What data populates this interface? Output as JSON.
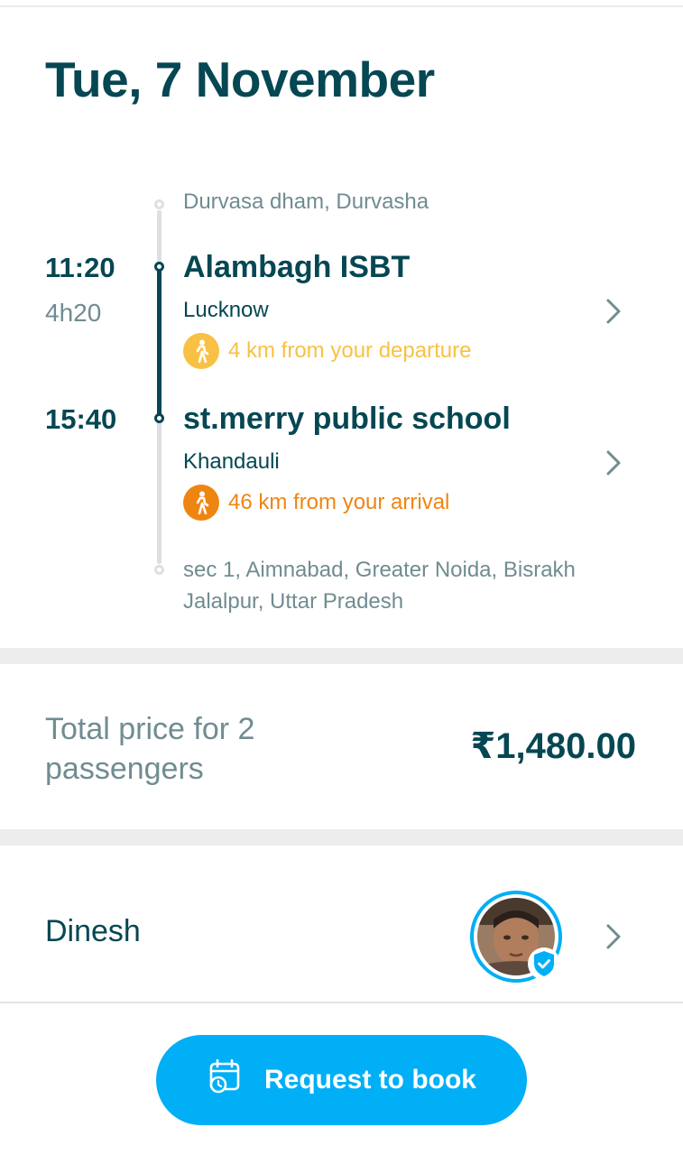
{
  "trip": {
    "date": "Tue, 7 November",
    "origin_area": "Durvasa dham, Durvasha",
    "departure": {
      "time": "11:20",
      "duration": "4h20",
      "stop": "Alambagh ISBT",
      "city": "Lucknow",
      "walk_note": "4 km from your departure",
      "walk_color": "#f8c144"
    },
    "arrival": {
      "time": "15:40",
      "stop": "st.merry public school",
      "city": "Khandauli",
      "walk_note": "46 km from your arrival",
      "walk_color": "#ef8511"
    },
    "destination_area_line1": "sec 1, Aimnabad, Greater Noida, Bisrakh",
    "destination_area_line2": "Jalalpur, Uttar Pradesh"
  },
  "price": {
    "label": "Total price for 2 passengers",
    "amount": "₹1,480.00"
  },
  "driver": {
    "name": "Dinesh",
    "verified": true
  },
  "cta": {
    "label": "Request to book",
    "icon": "calendar-clock-icon"
  },
  "colors": {
    "primary_text": "#054752",
    "muted_text": "#708c91",
    "accent": "#00aff5"
  }
}
